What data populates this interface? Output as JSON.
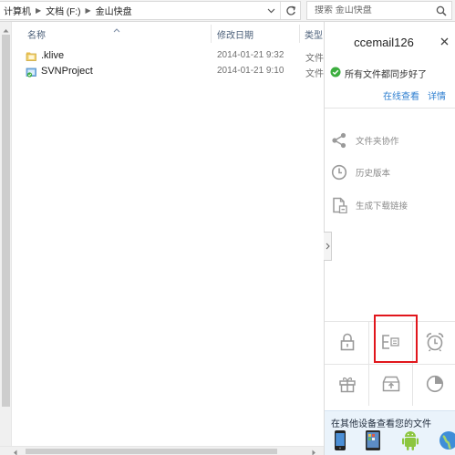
{
  "address_bar": {
    "crumbs": [
      "计算机",
      "文档 (F:)",
      "金山快盘"
    ]
  },
  "search": {
    "placeholder": "搜索 金山快盘"
  },
  "file_list": {
    "columns": [
      "名称",
      "修改日期",
      "类型"
    ],
    "rows": [
      {
        "name": ".klive",
        "date": "2014-01-21 9:32",
        "type": "文件",
        "icon": "folder-icon"
      },
      {
        "name": "SVNProject",
        "date": "2014-01-21 9:10",
        "type": "文件",
        "icon": "synced-folder-icon"
      }
    ]
  },
  "panel": {
    "account": "ccemail126",
    "sync_status": "所有文件都同步好了",
    "link_online": "在线查看",
    "link_detail": "详情",
    "actions": [
      {
        "label": "文件夹协作",
        "icon": "share-icon"
      },
      {
        "label": "历史版本",
        "icon": "clock-icon"
      },
      {
        "label": "生成下载链接",
        "icon": "link-file-icon"
      }
    ],
    "tool_icons": [
      "lock-icon",
      "edit-note-icon",
      "alarm-clock-icon",
      "gift-icon",
      "archive-upload-icon",
      "pie-chart-icon"
    ],
    "devices_title": "在其他设备查看您的文件",
    "device_icons": [
      "iphone-icon",
      "ipad-icon",
      "android-icon",
      "globe-icon"
    ]
  },
  "colors": {
    "link": "#2f7fd0",
    "status_ok": "#3cae3f",
    "highlight_box": "#e1161c",
    "devices_bg": "#eaf3fb"
  }
}
